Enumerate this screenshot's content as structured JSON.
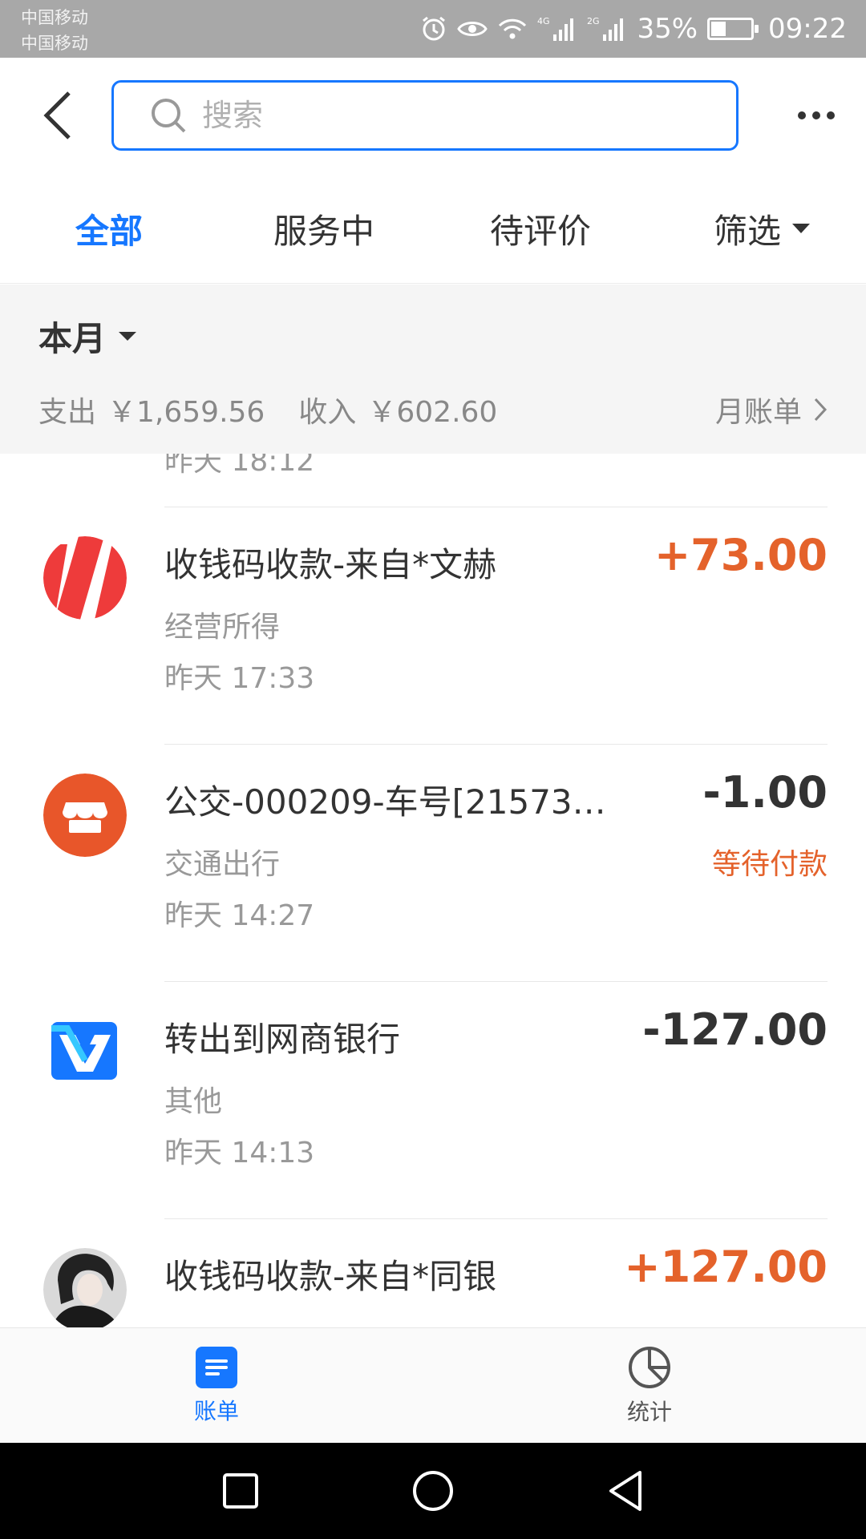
{
  "status_bar": {
    "carrier_1": "中国移动",
    "carrier_2": "中国移动",
    "network_1": "4G",
    "network_2": "2G",
    "battery": "35%",
    "time": "09:22"
  },
  "header": {
    "search": {
      "placeholder": "搜索",
      "value": ""
    }
  },
  "tabs": [
    {
      "label": "全部",
      "active": true
    },
    {
      "label": "服务中",
      "active": false
    },
    {
      "label": "待评价",
      "active": false
    },
    {
      "label": "筛选",
      "active": false
    }
  ],
  "summary": {
    "month": "本月",
    "expense_label": "支出",
    "expense_amount": "￥1,659.56",
    "income_label": "收入",
    "income_amount": "￥602.60",
    "bill_link": "月账单"
  },
  "list": {
    "prev_item_time": "昨天  18:12",
    "transactions": [
      {
        "title": "收钱码收款-来自*文赫",
        "amount": "+73.00",
        "category": "经营所得",
        "time": "昨天  17:33",
        "status": "",
        "type": "income",
        "avatar": "red-stripe-avatar"
      },
      {
        "title": "公交-000209-车号[21573…",
        "amount": "-1.00",
        "category": "交通出行",
        "time": "昨天  14:27",
        "status": "等待付款",
        "type": "expense",
        "avatar": "shop-icon"
      },
      {
        "title": "转出到网商银行",
        "amount": "-127.00",
        "category": "其他",
        "time": "昨天  14:13",
        "status": "",
        "type": "expense",
        "avatar": "mybank-logo-icon"
      },
      {
        "title": "收钱码收款-来自*同银",
        "amount": "+127.00",
        "category": "",
        "time": "",
        "status": "",
        "type": "income",
        "avatar": "photo-avatar"
      }
    ]
  },
  "bottom_nav": [
    {
      "label": "账单",
      "icon": "bill-icon",
      "active": true
    },
    {
      "label": "统计",
      "icon": "pie-chart-icon",
      "active": false
    }
  ],
  "colors": {
    "accent": "#1677ff",
    "income": "#e4622b",
    "status_bar": "#a8a8a8",
    "summary_bg": "#f5f5f5"
  }
}
